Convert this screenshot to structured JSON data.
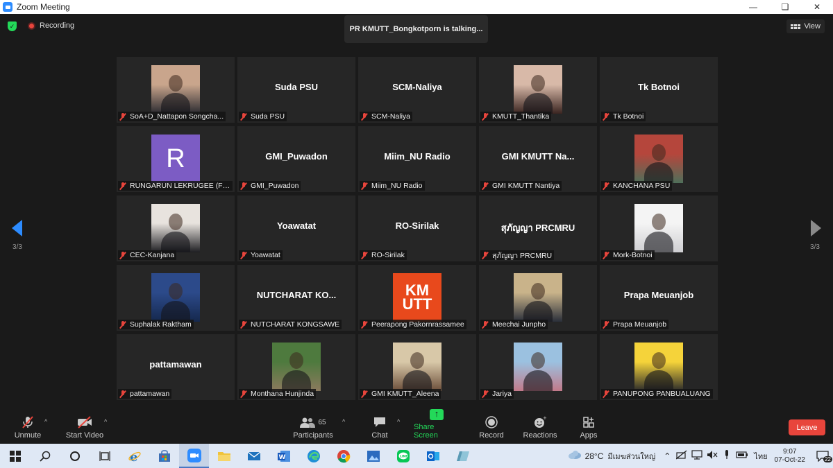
{
  "window": {
    "title": "Zoom Meeting"
  },
  "topbar": {
    "recording_label": "Recording",
    "talking_text": "PR KMUTT_Bongkotporn is talking...",
    "view_label": "View"
  },
  "pagination": {
    "left": "3/3",
    "right": "3/3"
  },
  "participants": [
    {
      "display": "photo",
      "label": "SoA+D_Nattapon Songcha...",
      "photo_colors": [
        "#c9a58c",
        "#2a2a30"
      ]
    },
    {
      "display": "name",
      "big_name": "Suda PSU",
      "label": "Suda PSU"
    },
    {
      "display": "name",
      "big_name": "SCM-Naliya",
      "label": "SCM-Naliya"
    },
    {
      "display": "photo",
      "label": "KMUTT_Thantika",
      "photo_colors": [
        "#d8b9a8",
        "#3a2420"
      ]
    },
    {
      "display": "name",
      "big_name": "Tk Botnoi",
      "label": "Tk Botnoi"
    },
    {
      "display": "avatar",
      "avatar_letter": "R",
      "label": "RUNGARUN LEKRUGEE (FS..."
    },
    {
      "display": "name",
      "big_name": "GMI_Puwadon",
      "label": "GMI_Puwadon"
    },
    {
      "display": "name",
      "big_name": "Miim_NU Radio",
      "label": "Miim_NU Radio"
    },
    {
      "display": "name",
      "big_name": "GMI  KMUTT  Na...",
      "label": "GMI KMUTT Nantiya"
    },
    {
      "display": "photo",
      "label": "KANCHANA PSU",
      "photo_colors": [
        "#b5463c",
        "#4f6f5a"
      ]
    },
    {
      "display": "photo",
      "label": "CEC-Kanjana",
      "photo_colors": [
        "#e8e3de",
        "#1e1e22"
      ]
    },
    {
      "display": "name",
      "big_name": "Yoawatat",
      "label": "Yoawatat"
    },
    {
      "display": "name",
      "big_name": "RO-Sirilak",
      "label": "RO-Sirilak"
    },
    {
      "display": "name",
      "big_name": "สุภัญญา PRCMRU",
      "label": "สุภัญญา PRCMRU"
    },
    {
      "display": "photo",
      "label": "Mork-Botnoi",
      "photo_colors": [
        "#f4f4f4",
        "#cfcfd2"
      ]
    },
    {
      "display": "photo",
      "label": "Suphalak Raktham",
      "photo_colors": [
        "#2c4a8a",
        "#15284d"
      ]
    },
    {
      "display": "name",
      "big_name": "NUTCHARAT  KO...",
      "label": "NUTCHARAT KONGSAWE"
    },
    {
      "display": "logo",
      "logo_top": "KM",
      "logo_bottom": "UTT",
      "label": "Peerapong Pakornrassamee"
    },
    {
      "display": "photo",
      "label": "Meechai Junpho",
      "photo_colors": [
        "#c9b38a",
        "#2a2f3a"
      ]
    },
    {
      "display": "name",
      "big_name": "Prapa Meuanjob",
      "label": "Prapa Meuanjob"
    },
    {
      "display": "name",
      "big_name": "pattamawan",
      "label": "pattamawan"
    },
    {
      "display": "photo",
      "label": "Monthana Hunjinda",
      "photo_colors": [
        "#4e7a3e",
        "#8b7a5e"
      ]
    },
    {
      "display": "photo",
      "label": "GMI KMUTT_Aleena",
      "photo_colors": [
        "#d8c8a8",
        "#6b4e3a"
      ]
    },
    {
      "display": "photo",
      "label": "Jariya",
      "photo_colors": [
        "#9bc1e0",
        "#c27a8a"
      ]
    },
    {
      "display": "photo",
      "label": "PANUPONG PANBUALUANG",
      "photo_colors": [
        "#f5d33a",
        "#2a2a2a"
      ]
    }
  ],
  "toolbar": {
    "unmute": "Unmute",
    "start_video": "Start Video",
    "participants_count": "65",
    "participants": "Participants",
    "chat": "Chat",
    "share_screen": "Share Screen",
    "record": "Record",
    "reactions": "Reactions",
    "apps": "Apps",
    "leave": "Leave"
  },
  "taskbar": {
    "weather": "28°C",
    "weather_location": "มีเมฆส่วนใหญ่",
    "language": "ไทย",
    "time": "9:07",
    "date": "07-Oct-22",
    "notification_count": "22"
  }
}
